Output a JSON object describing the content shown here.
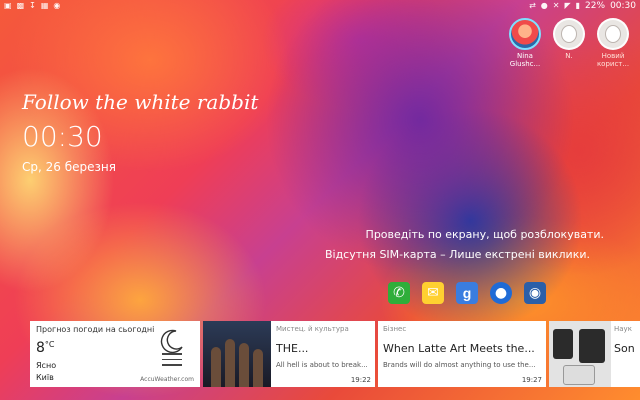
{
  "status": {
    "battery": "22%",
    "time": "00:30"
  },
  "users": [
    {
      "name": "Nina Glushc...",
      "active": true
    },
    {
      "name": "N.",
      "active": false
    },
    {
      "name": "Новий корист...",
      "active": false
    }
  ],
  "lockscreen": {
    "motto": "Follow the white rabbit",
    "clock": "00:30",
    "date": "Ср, 26 березня",
    "unlock_hint": "Проведіть по екрану, щоб розблокувати.",
    "sim_message": "Відсутня SIM-карта – Лише екстрені виклики."
  },
  "shortcuts": [
    {
      "icon": "phone-icon"
    },
    {
      "icon": "email-icon"
    },
    {
      "icon": "google-icon",
      "glyph": "g"
    },
    {
      "icon": "internet-icon"
    },
    {
      "icon": "camera-icon"
    }
  ],
  "cards": {
    "weather": {
      "title": "Прогноз погоди на сьогодні",
      "temp": "8",
      "unit": "°C",
      "condition": "Ясно",
      "city": "Київ",
      "brand": "AccuWeather.com"
    },
    "news1": {
      "category": "Мистец. й культура",
      "headline": "THE...",
      "snippet": "All hell is about to break...",
      "time": "19:22"
    },
    "news2": {
      "category": "Бізнес",
      "headline": "When Latte Art Meets the...",
      "snippet": "Brands will do almost anything to use the...",
      "time": "19:27"
    },
    "news3": {
      "category": "Наук",
      "headline": "Son"
    }
  }
}
